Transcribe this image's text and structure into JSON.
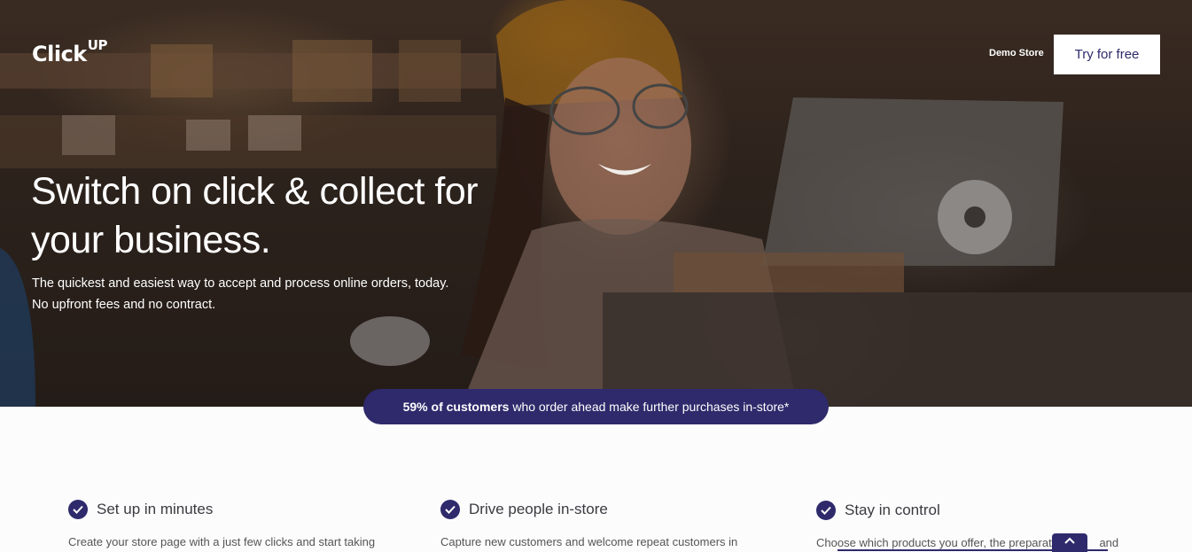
{
  "header": {
    "logo_text": "Click",
    "logo_sup": "UP",
    "demo_link": "Demo Store",
    "cta_button": "Try for free"
  },
  "hero": {
    "title": "Switch on click & collect for your business.",
    "subtitle_line1": "The quickest and easiest way to accept and process online orders, today.",
    "subtitle_line2": "No upfront fees and no contract."
  },
  "stat": {
    "bold": "59% of customers",
    "rest": " who order ahead make further purchases in-store*"
  },
  "features": [
    {
      "title": "Set up in minutes",
      "text": "Create your store page with a just few clicks and start taking"
    },
    {
      "title": "Drive people in-store",
      "text": "Capture new customers and welcome repeat customers in"
    },
    {
      "title": "Stay in control",
      "text": "Choose which products you offer, the preparatio",
      "text_tail": "and"
    }
  ],
  "colors": {
    "brand": "#2e2a6b",
    "white": "#ffffff"
  },
  "icons": {
    "check": "check-circle-icon",
    "scroll_top": "chevron-up-icon"
  }
}
